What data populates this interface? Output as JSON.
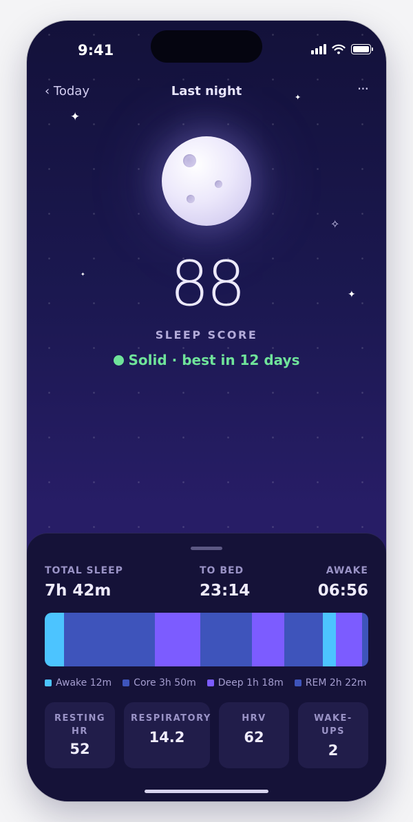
{
  "status_bar": {
    "time": "9:41"
  },
  "nav": {
    "back_label": "‹ Today",
    "title": "Last night",
    "more_label": "···"
  },
  "score": {
    "value": "88",
    "label": "SLEEP SCORE",
    "status": "Solid · best in 12 days",
    "status_color": "#6fe39a"
  },
  "summary": {
    "total_sleep_label": "TOTAL SLEEP",
    "total_sleep_value": "7h 42m",
    "to_bed_label": "TO BED",
    "to_bed_value": "23:14",
    "awake_label": "AWAKE",
    "awake_value": "06:56"
  },
  "timeline": {
    "segments": [
      {
        "stage": "Awake",
        "fraction": 0.06
      },
      {
        "stage": "Core",
        "fraction": 0.28
      },
      {
        "stage": "Deep",
        "fraction": 0.14
      },
      {
        "stage": "Core",
        "fraction": 0.16
      },
      {
        "stage": "Deep",
        "fraction": 0.1
      },
      {
        "stage": "Core",
        "fraction": 0.12
      },
      {
        "stage": "Awake",
        "fraction": 0.04
      },
      {
        "stage": "Deep",
        "fraction": 0.08
      },
      {
        "stage": "Core",
        "fraction": 0.02
      }
    ],
    "stage_colors": {
      "Awake": "#4cc4ff",
      "Core": "#3e54bb",
      "Deep": "#7c5cff",
      "REM": "#3e54bb"
    }
  },
  "legend": [
    {
      "label": "Awake 12m",
      "color": "#4cc4ff"
    },
    {
      "label": "Core 3h 50m",
      "color": "#3e54bb"
    },
    {
      "label": "Deep 1h 18m",
      "color": "#7c5cff"
    },
    {
      "label": "REM 2h 22m",
      "color": "#3e54bb"
    }
  ],
  "metrics": [
    {
      "label": "RESTING HR",
      "value": "52"
    },
    {
      "label": "RESPIRATORY",
      "value": "14.2"
    },
    {
      "label": "HRV",
      "value": "62"
    },
    {
      "label": "WAKE-UPS",
      "value": "2"
    }
  ]
}
